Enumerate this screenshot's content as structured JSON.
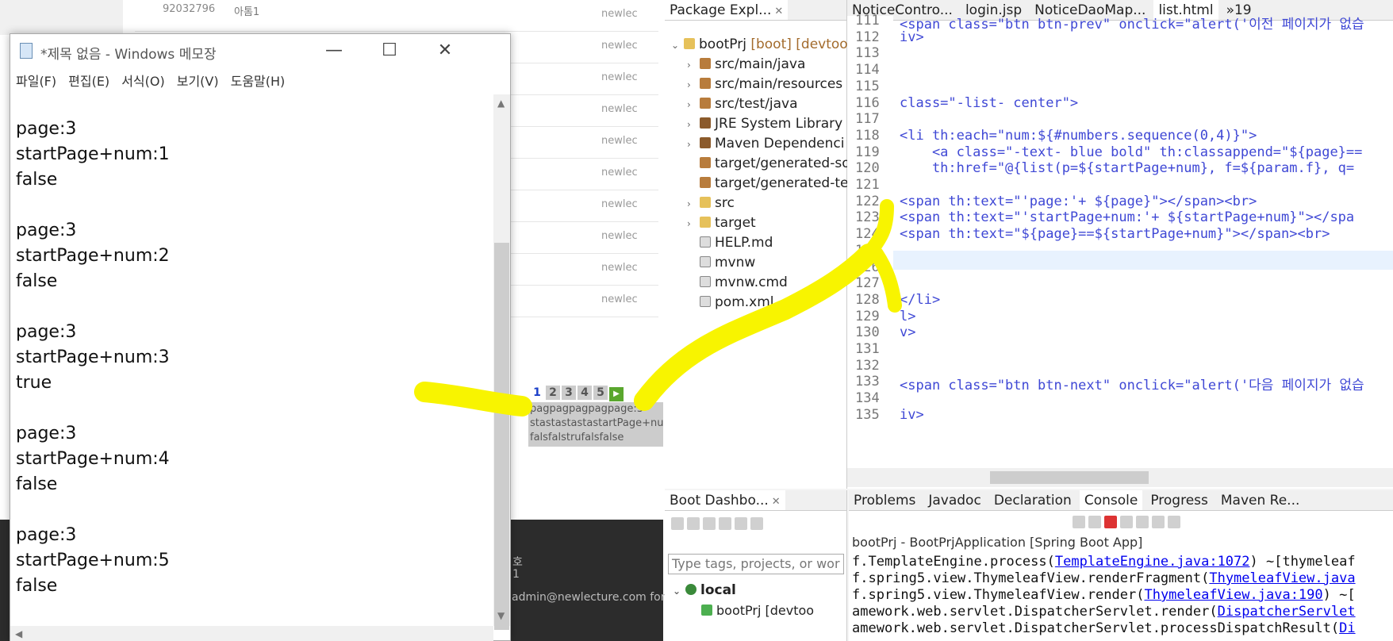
{
  "browser": {
    "rows": [
      {
        "id": "92032796",
        "title": "아톰1",
        "writer": "newlec"
      },
      {
        "id": "",
        "title": "",
        "writer": "newlec"
      },
      {
        "id": "",
        "title": "",
        "writer": "newlec"
      },
      {
        "id": "",
        "title": "",
        "writer": "newlec"
      },
      {
        "id": "",
        "title": "",
        "writer": "newlec"
      },
      {
        "id": "",
        "title": "",
        "writer": "newlec"
      },
      {
        "id": "",
        "title": "",
        "writer": "newlec"
      },
      {
        "id": "",
        "title": "",
        "writer": "newlec"
      },
      {
        "id": "",
        "title": "",
        "writer": "newlec"
      },
      {
        "id": "",
        "title": "",
        "writer": "newlec"
      }
    ],
    "pager": {
      "pages": [
        "1",
        "2",
        "3",
        "4",
        "5"
      ],
      "current": "1",
      "next": "▶"
    },
    "pager_text": [
      "pagpagpagpagpage:3",
      "stastastastastartPage+num",
      "falsfalstrufalsfalse"
    ],
    "footer_ho": "호",
    "footer_one": "1",
    "footer_email": "admin@newlecture.com for m"
  },
  "notepad": {
    "title": "*제목 없음 - Windows 메모장",
    "menu": [
      "파일(F)",
      "편집(E)",
      "서식(O)",
      "보기(V)",
      "도움말(H)"
    ],
    "lines": [
      "page:3",
      "startPage+num:1",
      "false",
      "",
      "page:3",
      "startPage+num:2",
      "false",
      "",
      "page:3",
      "startPage+num:3",
      "true",
      "",
      "page:3",
      "startPage+num:4",
      "false",
      "",
      "page:3",
      "startPage+num:5",
      "false"
    ],
    "min": "—",
    "max": "☐",
    "close": "✕"
  },
  "eclipse": {
    "pkg_tab": "Package Expl...",
    "project": "bootPrj",
    "project_dec": "[boot] [devtoo",
    "tree": [
      {
        "label": "src/main/java",
        "icon": "src",
        "arrow": true
      },
      {
        "label": "src/main/resources",
        "icon": "src",
        "arrow": true
      },
      {
        "label": "src/test/java",
        "icon": "src",
        "arrow": true
      },
      {
        "label": "JRE System Library",
        "icon": "jre",
        "arrow": true
      },
      {
        "label": "Maven Dependenci",
        "icon": "jre",
        "arrow": true
      },
      {
        "label": "target/generated-so",
        "icon": "src",
        "arrow": false
      },
      {
        "label": "target/generated-te",
        "icon": "src",
        "arrow": false
      },
      {
        "label": "src",
        "icon": "folder",
        "arrow": true
      },
      {
        "label": "target",
        "icon": "folder",
        "arrow": true
      },
      {
        "label": "HELP.md",
        "icon": "file",
        "arrow": false
      },
      {
        "label": "mvnw",
        "icon": "file",
        "arrow": false
      },
      {
        "label": "mvnw.cmd",
        "icon": "file",
        "arrow": false
      },
      {
        "label": "pom.xml",
        "icon": "file",
        "arrow": false
      }
    ],
    "editor_tabs": [
      "NoticeContro...",
      "login.jsp",
      "NoticeDaoMap...",
      "list.html"
    ],
    "tab_overflow": "»19",
    "lines": [
      {
        "n": "111",
        "code": "<span class=\"btn btn-prev\" onclick=\"alert('이전 페이지가 없습"
      },
      {
        "n": "112",
        "code": "iv>"
      },
      {
        "n": "113",
        "code": ""
      },
      {
        "n": "114",
        "code": ""
      },
      {
        "n": "115",
        "code": ""
      },
      {
        "n": "116",
        "code": "class=\"-list- center\">"
      },
      {
        "n": "117",
        "code": ""
      },
      {
        "n": "118",
        "code": "<li th:each=\"num:${#numbers.sequence(0,4)}\">"
      },
      {
        "n": "119",
        "code": "    <a class=\"-text- blue bold\" th:classappend=\"${page}=="
      },
      {
        "n": "120",
        "code": "    th:href=\"@{list(p=${startPage+num}, f=${param.f}, q="
      },
      {
        "n": "121",
        "code": ""
      },
      {
        "n": "122",
        "code": "<span th:text=\"'page:'+ ${page}\"></span><br>"
      },
      {
        "n": "123",
        "code": "<span th:text=\"'startPage+num:'+ ${startPage+num}\"></spa"
      },
      {
        "n": "124",
        "code": "<span th:text=\"${page}==${startPage+num}\"></span><br>"
      },
      {
        "n": "125",
        "code": ""
      },
      {
        "n": "126",
        "code": ""
      },
      {
        "n": "127",
        "code": ""
      },
      {
        "n": "128",
        "code": "</li>"
      },
      {
        "n": "129",
        "code": "l>"
      },
      {
        "n": "130",
        "code": "v>"
      },
      {
        "n": "131",
        "code": ""
      },
      {
        "n": "132",
        "code": ""
      },
      {
        "n": "133",
        "code": "<span class=\"btn btn-next\" onclick=\"alert('다음 페이지가 없습"
      },
      {
        "n": "134",
        "code": ""
      },
      {
        "n": "135",
        "code": "iv>"
      }
    ],
    "dash_tab": "Boot Dashbo...",
    "dash_search": "Type tags, projects, or wor",
    "dash_local": "local",
    "dash_item": "bootPrj [devtoo",
    "console_tabs": [
      "Problems",
      "Javadoc",
      "Declaration",
      "Console",
      "Progress",
      "Maven Re..."
    ],
    "console_title": "bootPrj - BootPrjApplication [Spring Boot App]",
    "console_lines": [
      {
        "pre": "f.TemplateEngine.process(",
        "link": "TemplateEngine.java:1072",
        "post": ") ~[thymeleaf"
      },
      {
        "pre": "f.spring5.view.ThymeleafView.renderFragment(",
        "link": "ThymeleafView.java",
        "post": ""
      },
      {
        "pre": "f.spring5.view.ThymeleafView.render(",
        "link": "ThymeleafView.java:190",
        "post": ") ~["
      },
      {
        "pre": "amework.web.servlet.DispatcherServlet.render(",
        "link": "DispatcherServlet",
        "post": ""
      },
      {
        "pre": "amework.web.servlet.DispatcherServlet.processDispatchResult(",
        "link": "Di",
        "post": ""
      }
    ]
  }
}
